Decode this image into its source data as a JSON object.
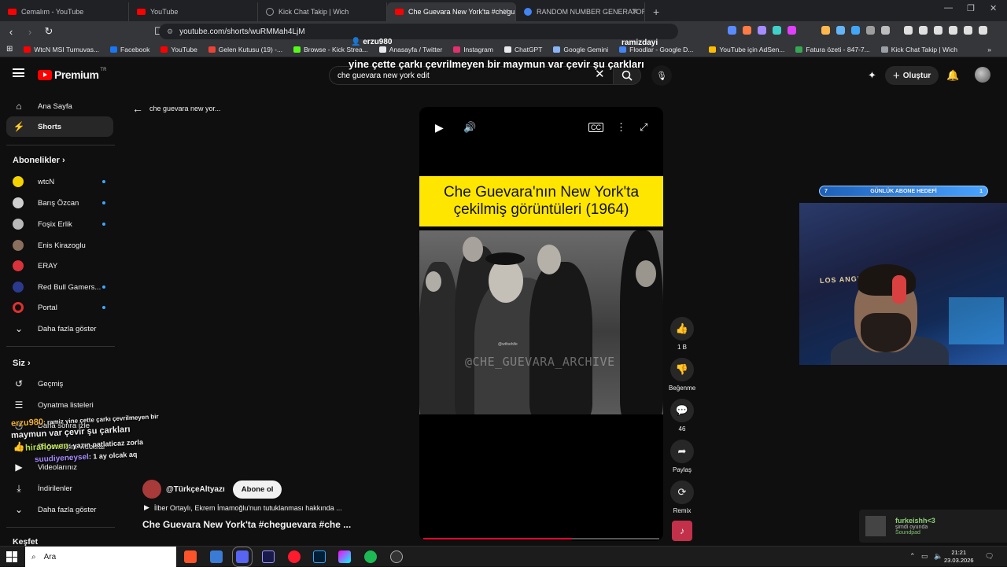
{
  "browser": {
    "tabs": [
      {
        "title": "Cemalım - YouTube",
        "icon": "youtube-icon",
        "active": false
      },
      {
        "title": "YouTube",
        "icon": "youtube-icon",
        "active": false
      },
      {
        "title": "Kick Chat Takip | Wich",
        "icon": "globe-icon",
        "active": false
      },
      {
        "title": "Che Guevara New York'ta #chegu",
        "icon": "youtube-icon",
        "active": true
      },
      {
        "title": "RANDOM NUMBER GENERATOR - G",
        "icon": "google-icon",
        "active": false
      }
    ],
    "url": "youtube.com/shorts/wuRMMah4LjM",
    "bookmarks": [
      {
        "label": "WtcN MSI Turnuvas...",
        "color": "#ff0000"
      },
      {
        "label": "Facebook",
        "color": "#1877f2"
      },
      {
        "label": "YouTube",
        "color": "#ff0000"
      },
      {
        "label": "Gelen Kutusu (19) -...",
        "color": "#ea4335"
      },
      {
        "label": "Browse - Kick Strea...",
        "color": "#53fc18"
      },
      {
        "label": "Anasayfa / Twitter",
        "color": "#e8eaed"
      },
      {
        "label": "Instagram",
        "color": "#e1306c"
      },
      {
        "label": "ChatGPT",
        "color": "#e8eaed"
      },
      {
        "label": "Google Gemini",
        "color": "#8ab4f8"
      },
      {
        "label": "Floodlar - Google D...",
        "color": "#4285f4"
      },
      {
        "label": "YouTube için AdSen...",
        "color": "#fbbc04"
      },
      {
        "label": "Fatura özeti - 847-7...",
        "color": "#34a853"
      },
      {
        "label": "Kick Chat Takip | Wich",
        "color": "#9aa0a6"
      }
    ]
  },
  "youtube": {
    "logo_text": "Premium",
    "logo_region": "TR",
    "search_value": "che guevara new york edit",
    "create_label": "Oluştur",
    "sidebar": {
      "home": "Ana Sayfa",
      "shorts": "Shorts",
      "subscriptions_header": "Abonelikler",
      "subscriptions": [
        {
          "name": "wtcN",
          "color": "#f5d300"
        },
        {
          "name": "Barış Özcan",
          "color": "#cfcfcf"
        },
        {
          "name": "Foşix Erlik",
          "color": "#b9b9b9"
        },
        {
          "name": "Enis Kirazoglu",
          "color": "#8a6f5e"
        },
        {
          "name": "ERAY",
          "color": "#d9323a"
        },
        {
          "name": "Red Bull Gamers...",
          "color": "#2b3a8f"
        },
        {
          "name": "Portal",
          "color": "#e03030"
        }
      ],
      "show_more_1": "Daha fazla göster",
      "you_header": "Siz",
      "history": "Geçmiş",
      "playlists": "Oynatma listeleri",
      "watch_later": "Daha sonra izle",
      "liked": "Beğendiğim videolar",
      "your_videos": "Videolarınız",
      "downloads": "İndirilenler",
      "show_more_2": "Daha fazla göster",
      "explore_header": "Keşfet"
    },
    "back_label": "che guevara new yor...",
    "short": {
      "banner_line1": "Che Guevara'nın New York'ta",
      "banner_line2": "çekilmiş görüntüleri (1964)",
      "watermark": "@CHE_GUEVARA_ARCHIVE",
      "watermark_small": "@wtfsehife",
      "progress_fraction": 0.63,
      "likes": "1 B",
      "dislike_label": "Beğenme",
      "comments": "46",
      "share_label": "Paylaş",
      "remix_label": "Remix",
      "channel": "@TürkçeAltyazı",
      "subscribe_label": "Abone ol",
      "related": "İlber Ortaylı, Ekrem İmamoğlu'nun tutuklanması hakkında ...",
      "title": "Che Guevara New York'ta #cheguevara #che ..."
    }
  },
  "stream_overlay": {
    "top_user_left": "erzu980",
    "top_user_right": "ramizdayi",
    "top_message": "yine çette çarkı çevrilmeyen bir maymun var çevir şu çarkları",
    "goal_left": "7",
    "goal_label": "GÜNLÜK ABONE HEDEFİ",
    "goal_right": "1",
    "webcam_sign": "LOS ANGELES",
    "chat": [
      {
        "user": "erzu980",
        "text": ": ramiz yine çette çarkı çevrilmeyen bir",
        "user_color": "#f2b233"
      },
      {
        "user": "",
        "text": "maymun var çevir şu çarkları",
        "user_color": "#ffffff"
      },
      {
        "user": "hiraflowen",
        "text": ": yazın patlaticaz zorla",
        "user_color": "#b8e04a"
      },
      {
        "user": "suudiyeneysel",
        "text": ": 1 ay olcak aq",
        "user_color": "#a68bff"
      }
    ],
    "now_playing": {
      "title": "furkeishh<3",
      "status": "şimdi oyunda",
      "source": "Soundpad"
    }
  },
  "taskbar": {
    "search_placeholder": "Ara",
    "time": "21:21",
    "date": "23.03.2026"
  }
}
